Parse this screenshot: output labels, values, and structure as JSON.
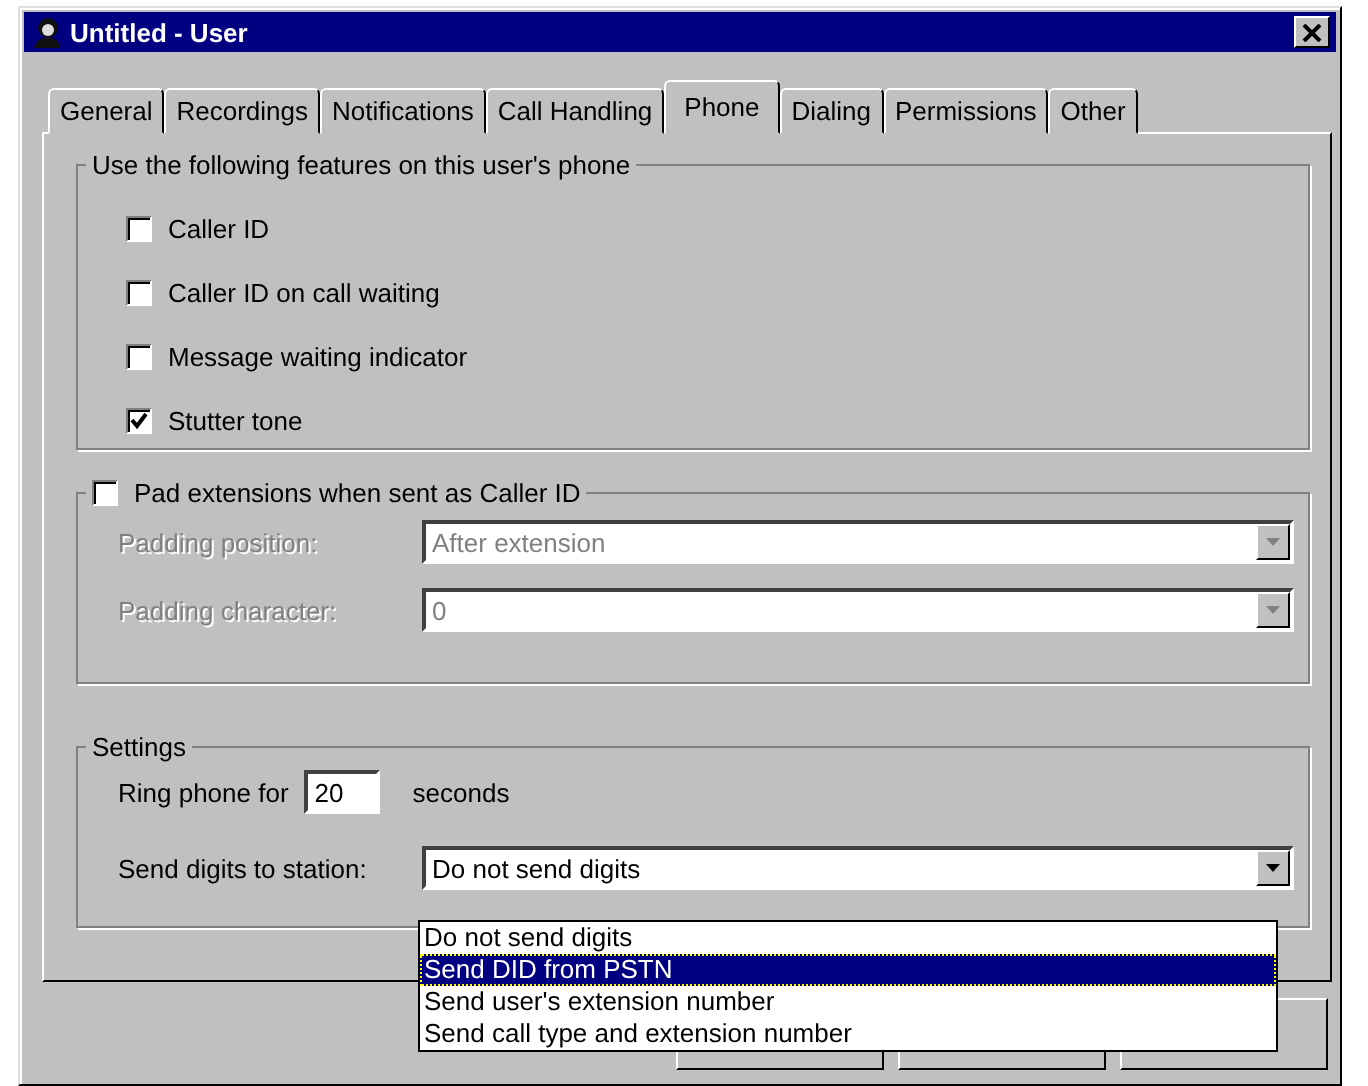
{
  "window": {
    "title": "Untitled - User"
  },
  "tabs": [
    {
      "label": "General",
      "selected": false
    },
    {
      "label": "Recordings",
      "selected": false
    },
    {
      "label": "Notifications",
      "selected": false
    },
    {
      "label": "Call Handling",
      "selected": false
    },
    {
      "label": "Phone",
      "selected": true
    },
    {
      "label": "Dialing",
      "selected": false
    },
    {
      "label": "Permissions",
      "selected": false
    },
    {
      "label": "Other",
      "selected": false
    }
  ],
  "features": {
    "title": "Use the following features on this user's phone",
    "options": [
      {
        "label": "Caller ID",
        "checked": false
      },
      {
        "label": "Caller ID on call waiting",
        "checked": false
      },
      {
        "label": "Message waiting indicator",
        "checked": false
      },
      {
        "label": "Stutter tone",
        "checked": true
      }
    ]
  },
  "padding": {
    "label": "Pad extensions when sent as Caller ID",
    "checked": false,
    "fields": [
      {
        "label": "Padding position:",
        "value": "After extension",
        "disabled": true
      },
      {
        "label": "Padding character:",
        "value": "0",
        "disabled": true
      }
    ]
  },
  "settings": {
    "title": "Settings",
    "ring_label": "Ring phone for",
    "ring_value": "20",
    "ring_unit": "seconds",
    "send_label": "Send digits to station:",
    "send_value": "Do not send digits",
    "expanded": true,
    "options": [
      {
        "label": "Do not send digits",
        "selected": false
      },
      {
        "label": "Send DID from PSTN",
        "selected": true
      },
      {
        "label": "Send user's extension number",
        "selected": false
      },
      {
        "label": "Send call type and extension number",
        "selected": false
      }
    ]
  }
}
